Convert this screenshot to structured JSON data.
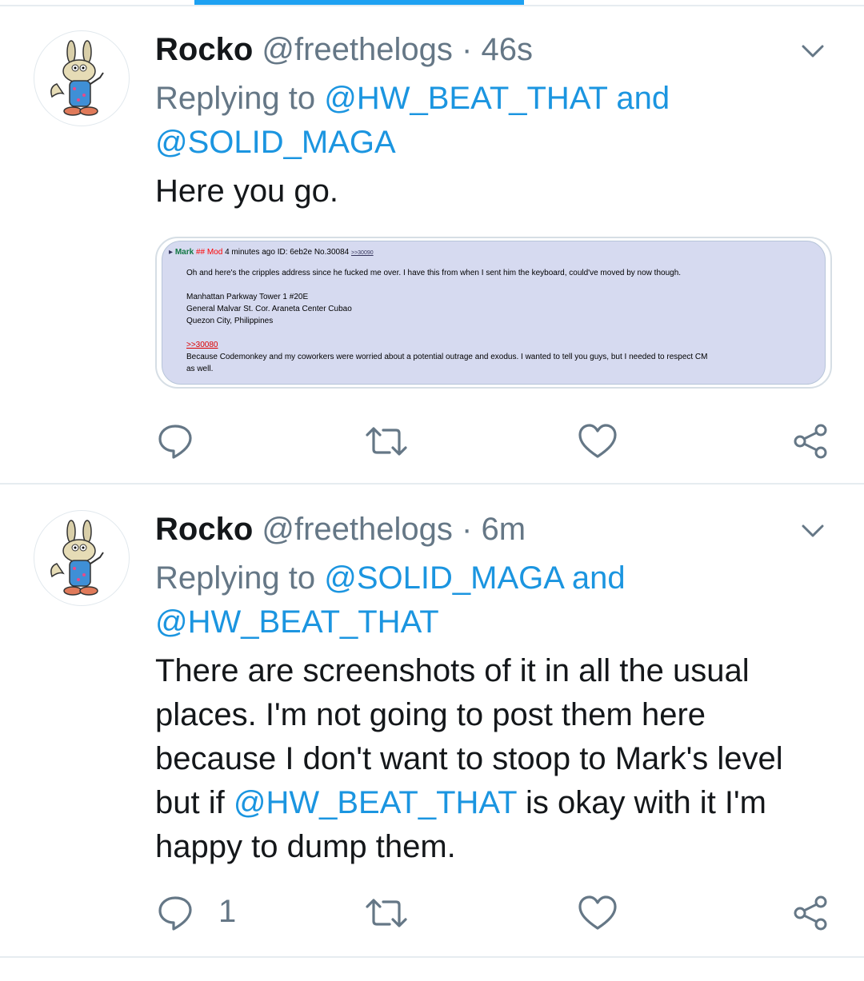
{
  "colors": {
    "accent": "#1da1f2",
    "mention": "#1b95e0",
    "muted": "#657786",
    "text": "#14171a"
  },
  "icons": [
    "chevron-down-icon",
    "reply-icon",
    "retweet-icon",
    "like-icon",
    "share-icon"
  ],
  "tweets": [
    {
      "display_name": "Rocko",
      "handle": "@freethelogs",
      "separator": "·",
      "time": "46s",
      "replying_prefix": "Replying to",
      "replying_first": "@HW_BEAT_THAT",
      "replying_and": "and",
      "replying_second": "@SOLID_MAGA",
      "text": "Here you go.",
      "media": {
        "arrow": "▸",
        "name": "Mark",
        "trip": "## Mod",
        "meta": "4 minutes ago ID: 6eb2e No.30084",
        "ref": ">>30090",
        "line1": "Oh and here's the cripples address since he fucked me over. I have this from when I sent him the keyboard, could've moved by now though.",
        "addr1": "Manhattan Parkway Tower 1 #20E",
        "addr2": "General Malvar St. Cor. Araneta Center Cubao",
        "addr3": "Quezon City, Philippines",
        "quote": ">>30080",
        "line2a": "Because Codemonkey and my coworkers were worried about a potential outrage and exodus. I wanted to tell you guys, but I needed to respect CM",
        "line2b": "as well."
      },
      "reply_count": ""
    },
    {
      "display_name": "Rocko",
      "handle": "@freethelogs",
      "separator": "·",
      "time": "6m",
      "replying_prefix": "Replying to",
      "replying_first": "@SOLID_MAGA",
      "replying_and": "and",
      "replying_second": "@HW_BEAT_THAT",
      "text_part1": "There are screenshots of it in all the usual places. I'm not going to post them here because I don't want to stoop to Mark's level but if",
      "text_mention": "@HW_BEAT_THAT",
      "text_part2": "is okay with it I'm happy to dump them.",
      "reply_count": "1"
    }
  ]
}
